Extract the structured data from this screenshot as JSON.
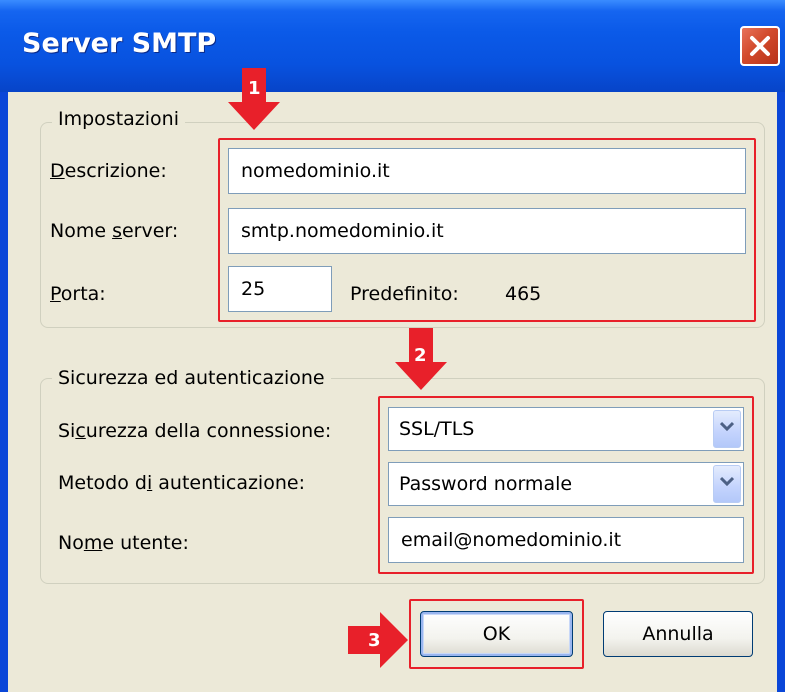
{
  "window": {
    "title": "Server SMTP",
    "close_glyph": "✕"
  },
  "settings_group": {
    "legend": "Impostazioni",
    "description_label_prefix": "D",
    "description_label_rest": "escrizione:",
    "description_value": "nomedominio.it",
    "server_label_prefix": "Nome ",
    "server_label_mnemonic": "s",
    "server_label_rest": "erver:",
    "server_value": "smtp.nomedominio.it",
    "port_label_prefix": "P",
    "port_label_rest": "orta:",
    "port_value": "25",
    "default_label": "Predefinito:",
    "default_value": "465"
  },
  "security_group": {
    "legend": "Sicurezza ed autenticazione",
    "connection_label_prefix": "Si",
    "connection_label_mnemonic": "c",
    "connection_label_rest": "urezza della connessione:",
    "connection_value": "SSL/TLS",
    "auth_label_prefix": "Metodo d",
    "auth_label_mnemonic": "i",
    "auth_label_rest": " autenticazione:",
    "auth_value": "Password normale",
    "username_label_prefix": "No",
    "username_label_mnemonic": "m",
    "username_label_rest": "e utente:",
    "username_value": "email@nomedominio.it"
  },
  "buttons": {
    "ok_label": "OK",
    "cancel_label": "Annulla"
  },
  "annotations": {
    "marker_1": "1",
    "marker_2": "2",
    "marker_3": "3",
    "color": "#e8202a"
  },
  "icons": [
    "close-icon",
    "chevron-down-icon",
    "arrow-down-marker",
    "arrow-right-marker"
  ]
}
